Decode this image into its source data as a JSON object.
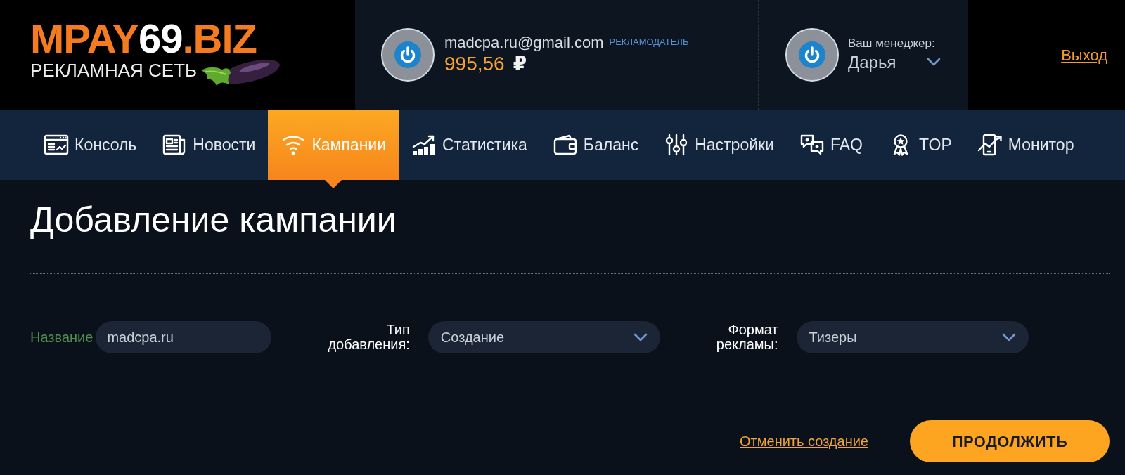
{
  "logo": {
    "wordmark": "MPAY**69**.BIZ",
    "tagline": "РЕКЛАМНАЯ СЕТЬ"
  },
  "account": {
    "email": "madcpa.ru@gmail.com",
    "role": "РЕКЛАМОДАТЕЛЬ",
    "balance": "995,56",
    "currency": "₽"
  },
  "manager": {
    "label": "Ваш менеджер:",
    "name": "Дарья"
  },
  "logout": "Выход",
  "nav": [
    {
      "label": "Консоль",
      "selected": false
    },
    {
      "label": "Новости",
      "selected": false
    },
    {
      "label": "Кампании",
      "selected": true
    },
    {
      "label": "Статистика",
      "selected": false
    },
    {
      "label": "Баланс",
      "selected": false
    },
    {
      "label": "Настройки",
      "selected": false
    },
    {
      "label": "FAQ",
      "selected": false
    },
    {
      "label": "TOP",
      "selected": false
    },
    {
      "label": "Монитор",
      "selected": false
    }
  ],
  "page_title": "Добавление кампании",
  "form": {
    "fields": [
      {
        "kind": "text",
        "label": "Название",
        "value": "madcpa.ru"
      },
      {
        "kind": "select",
        "label": "Тип добавления:",
        "value": "Создание"
      },
      {
        "kind": "select",
        "label": "Формат рекламы:",
        "value": "Тизеры"
      }
    ]
  },
  "actions": {
    "cancel": "Отменить создание",
    "submit": "ПРОДОЛЖИТЬ"
  }
}
